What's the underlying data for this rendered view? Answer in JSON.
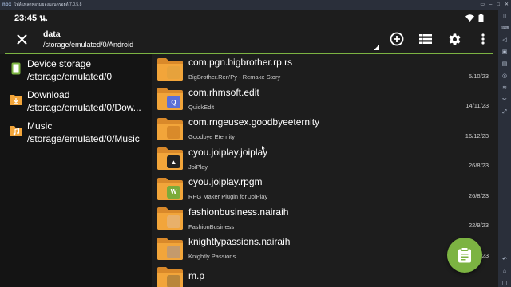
{
  "status_bar": {
    "time": "23:45 น."
  },
  "emulator": {
    "title": "ไฟล์แพลตฟอร์มของแอนดรอยด์ 7.0.5.8",
    "logo": "nox"
  },
  "toolbar": {
    "title": "data",
    "path": "/storage/emulated/0/Android"
  },
  "icons": {
    "close": "close-icon",
    "add": "add-circle-icon",
    "list": "list-view-icon",
    "settings": "gear-icon",
    "more": "more-vert-icon",
    "fab": "clipboard-icon"
  },
  "storage": [
    {
      "name": "Device storage",
      "path": "/storage/emulated/0",
      "icon": "phone-icon"
    },
    {
      "name": "Download",
      "path": "/storage/emulated/0/Dow...",
      "icon": "download-folder-icon"
    },
    {
      "name": "Music",
      "path": "/storage/emulated/0/Music",
      "icon": "music-folder-icon"
    }
  ],
  "files": [
    {
      "name": "com.pgn.bigbrother.rp.rs",
      "desc": "BigBrother.Ren'Py - Remake Story",
      "date": "5/10/23",
      "badge": "",
      "badge_color": "#e6a23c"
    },
    {
      "name": "com.rhmsoft.edit",
      "desc": "QuickEdit",
      "date": "14/11/23",
      "badge": "Q",
      "badge_color": "#5b6fd6"
    },
    {
      "name": "com.rngeusex.goodbyeeternity",
      "desc": "Goodbye Eternity",
      "date": "16/12/23",
      "badge": "",
      "badge_color": "#d98a2a"
    },
    {
      "name": "cyou.joiplay.joiplay",
      "desc": "JoiPlay",
      "date": "26/8/23",
      "badge": "▲",
      "badge_color": "#222222"
    },
    {
      "name": "cyou.joiplay.rpgm",
      "desc": "RPG Maker Plugin for JoiPlay",
      "date": "26/8/23",
      "badge": "W",
      "badge_color": "#7cab3a"
    },
    {
      "name": "fashionbusiness.nairaih",
      "desc": "FashionBusiness",
      "date": "22/9/23",
      "badge": "",
      "badge_color": "#e8b06a"
    },
    {
      "name": "knightlypassions.nairaih",
      "desc": "Knightly Passions",
      "date": "26/9/23",
      "badge": "",
      "badge_color": "#c49a6c"
    },
    {
      "name": "m.p",
      "desc": "",
      "date": "",
      "badge": "",
      "badge_color": "#b9863a"
    }
  ],
  "colors": {
    "accent": "#7cb342",
    "folder": "#f2a53a",
    "folder_dark": "#d9892a"
  }
}
